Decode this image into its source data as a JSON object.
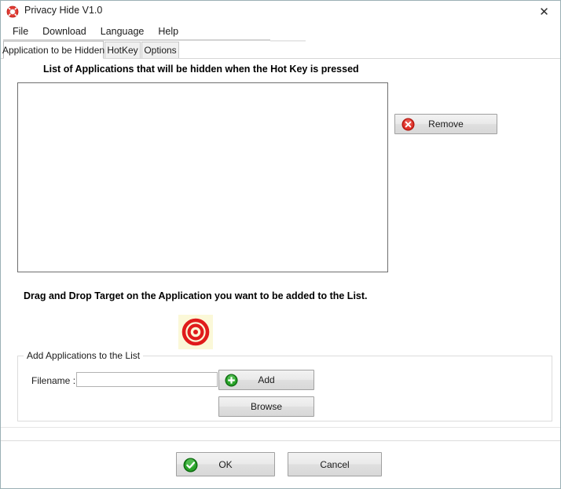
{
  "window": {
    "title": "Privacy Hide V1.0",
    "app_icon": "lifering-icon",
    "close_label": "✕"
  },
  "menubar": {
    "items": [
      {
        "label": "File"
      },
      {
        "label": "Download"
      },
      {
        "label": "Language"
      },
      {
        "label": "Help"
      }
    ]
  },
  "tabs": [
    {
      "label": "Application to be Hidden",
      "active": true
    },
    {
      "label": "HotKey",
      "active": false
    },
    {
      "label": "Options",
      "active": false
    }
  ],
  "main": {
    "list_heading": "List of Applications that will be hidden when the Hot Key is pressed",
    "listbox_items": [],
    "remove_label": "Remove",
    "remove_icon": "red-x-circle-icon",
    "drag_drop_text": "Drag and Drop Target on the Application you want to be added to the List.",
    "target_icon": "bullseye-target-icon"
  },
  "groupbox": {
    "label": "Add Applications to the List",
    "filename_label": "Filename :",
    "filename_value": "",
    "filename_placeholder": "",
    "add_label": "Add",
    "add_icon": "green-plus-circle-icon",
    "browse_label": "Browse"
  },
  "footer": {
    "ok_label": "OK",
    "ok_icon": "green-check-circle-icon",
    "cancel_label": "Cancel"
  },
  "colors": {
    "window_border": "#9bb0b5",
    "accent_red": "#d8232a",
    "accent_green": "#1f9a1f",
    "target_bg": "#fbf8d8",
    "button_face": "#eaeaea",
    "listbox_border": "#6e6e6e"
  }
}
